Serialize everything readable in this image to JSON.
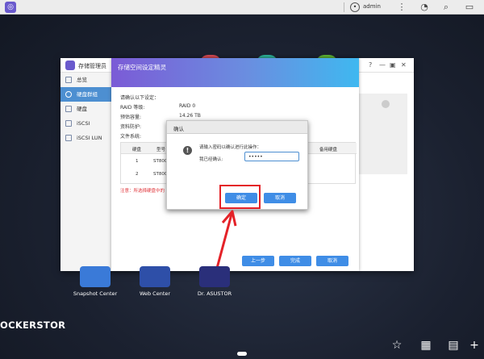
{
  "taskbar": {
    "user": "admin"
  },
  "desktop": {
    "icons": [
      {
        "label": "Snapshot Center"
      },
      {
        "label": "Web Center"
      },
      {
        "label": "Dr. ASUSTOR"
      }
    ],
    "brand": "OCKERSTOR"
  },
  "storage_window": {
    "title": "存储管理员",
    "sidebar": [
      "总览",
      "硬盘群组",
      "硬盘",
      "iSCSI",
      "iSCSI LUN"
    ],
    "active_index": 1
  },
  "wizard": {
    "title": "存储空间设定精灵",
    "intro": "请确认以下设定：",
    "rows": [
      {
        "label": "RAID 等级:",
        "value": "RAID 0"
      },
      {
        "label": "预估容量:",
        "value": "14.26 TB"
      },
      {
        "label": "资料防护:",
        "value": ""
      },
      {
        "label": "文件系统:",
        "value": ""
      }
    ],
    "table": {
      "headers": [
        "硬盘",
        "型号",
        "备用硬盘"
      ],
      "rows": [
        {
          "disk": "1",
          "model": "ST800"
        },
        {
          "disk": "2",
          "model": "ST800"
        }
      ]
    },
    "note": "注意：所选择硬盘中的",
    "buttons": {
      "prev": "上一步",
      "finish": "完成",
      "cancel": "取消"
    }
  },
  "dialog": {
    "title": "确认",
    "message": "请输入密码以确认进行此操作：",
    "field_label": "我已经确认:",
    "password": "•••••",
    "ok": "确定",
    "cancel": "取消"
  },
  "colors": {
    "accent": "#3f8de6",
    "highlight": "#e42228"
  }
}
